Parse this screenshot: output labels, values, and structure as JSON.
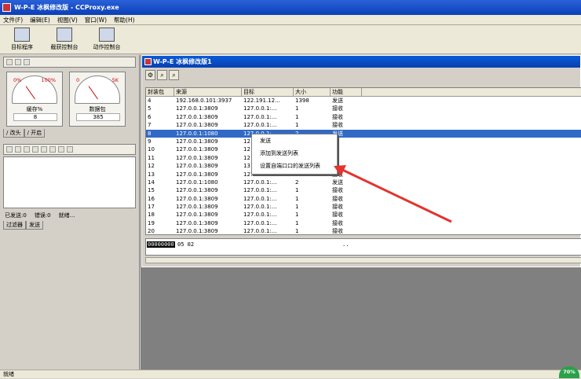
{
  "app": {
    "title": "W-P-E 冰枫修改版 - CCProxy.exe"
  },
  "menu": [
    "文件(F)",
    "编辑(E)",
    "视图(V)",
    "窗口(W)",
    "帮助(H)"
  ],
  "toolbar": {
    "target": "目标程序",
    "capture": "截获控制台",
    "action": "动作控制台"
  },
  "gauges": [
    {
      "lo": "0%",
      "hi": "100%",
      "label": "缓存%",
      "value": "8",
      "level_fraction": 0.08
    },
    {
      "lo": "0",
      "hi": "5K",
      "label": "数据包",
      "value": "385",
      "level_fraction": 0.08
    }
  ],
  "left_tabs_top": [
    "/ 改头",
    "/ 开启"
  ],
  "left_tabs_bottom": [
    "过滤器",
    "发送"
  ],
  "status_counts": {
    "sent": "已发送:0",
    "errors": "错误:0",
    "pending": "就绪..."
  },
  "child": {
    "title": "W-P-E 冰枫修改版1"
  },
  "columns": [
    "封装包",
    "来源",
    "目标",
    "大小",
    "功能"
  ],
  "rows": [
    [
      "4",
      "192.168.0.101:3937",
      "122.191.12...",
      "1398",
      "发送"
    ],
    [
      "5",
      "127.0.0.1:3809",
      "127.0.0.1:...",
      "1",
      "接收"
    ],
    [
      "6",
      "127.0.0.1:3809",
      "127.0.0.1:...",
      "1",
      "接收"
    ],
    [
      "7",
      "127.0.0.1:3809",
      "127.0.0.1:...",
      "1",
      "接收"
    ],
    [
      "8",
      "127.0.0.1:1080",
      "127.0.0.1:...",
      "2",
      "发送"
    ],
    [
      "9",
      "127.0.0.1:3809",
      "12",
      "",
      "收"
    ],
    [
      "10",
      "127.0.0.1:3809",
      "12",
      "",
      "收"
    ],
    [
      "11",
      "127.0.0.1:3809",
      "12",
      "",
      "收"
    ],
    [
      "12",
      "127.0.0.1:3809",
      "13",
      "",
      "收"
    ],
    [
      "13",
      "127.0.0.1:3809",
      "127.0.0.1:...",
      "1",
      "接收"
    ],
    [
      "14",
      "127.0.0.1:1080",
      "127.0.0.1:...",
      "2",
      "发送"
    ],
    [
      "15",
      "127.0.0.1:3809",
      "127.0.0.1:...",
      "1",
      "接收"
    ],
    [
      "16",
      "127.0.0.1:3809",
      "127.0.0.1:...",
      "1",
      "接收"
    ],
    [
      "17",
      "127.0.0.1:3809",
      "127.0.0.1:...",
      "1",
      "接收"
    ],
    [
      "18",
      "127.0.0.1:3809",
      "127.0.0.1:...",
      "1",
      "接收"
    ],
    [
      "19",
      "127.0.0.1:3809",
      "127.0.0.1:...",
      "1",
      "接收"
    ],
    [
      "20",
      "127.0.0.1:3809",
      "127.0.0.1:...",
      "1",
      "接收"
    ]
  ],
  "hex": {
    "addr": "00000000",
    "bytes": "05 02",
    "ascii": ".."
  },
  "context_menu": [
    "发送",
    "添加到发送列表",
    "设置自端口口的发送列表"
  ],
  "status_bar": "就绪",
  "badge": "70%",
  "colors": {
    "title": "#0a3fb8",
    "selection": "#316ac5",
    "arrow": "#e3342f"
  }
}
